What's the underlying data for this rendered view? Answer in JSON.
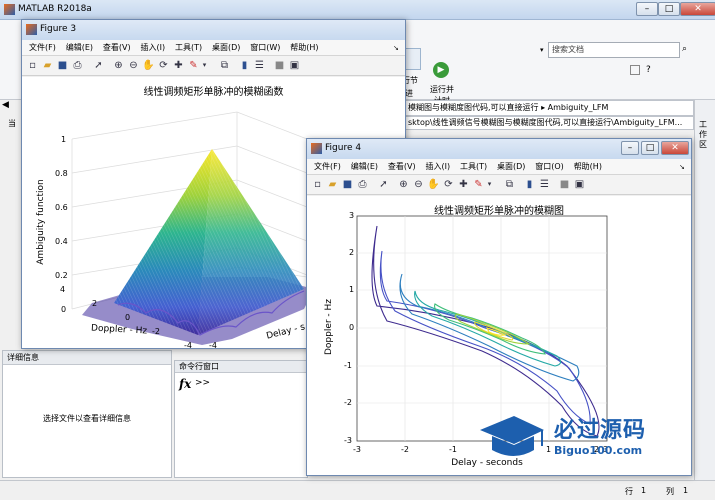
{
  "matlab": {
    "title": "MATLAB R2018a",
    "search_placeholder": "搜索文档",
    "ribbon": {
      "run_section_a": "行节",
      "run_section_b": "进",
      "run_and_time_a": "运行并",
      "run_and_time_b": "计时"
    },
    "address_bar": "模糊图与模糊度图代码,可以直接运行 ▸ Ambiguity_LFM",
    "path_bar": "sktop\\线性调频信号模糊图与模糊度图代码,可以直接运行\\Ambiguity_LFM...",
    "left_tab": "当",
    "details_panel": {
      "header": "详细信息",
      "message": "选择文件以查看详细信息"
    },
    "command_window": {
      "header": "命令行窗口",
      "fx": "fx",
      "prompt": ">>"
    },
    "workspace_tab": "工作区",
    "status": {
      "row_label": "行",
      "row_value": "1",
      "col_label": "列",
      "col_value": "1"
    },
    "colors": {
      "accent": "#3c7fb1",
      "title_bar": "#c7d9ef",
      "close_red": "#c9473a"
    }
  },
  "figure3": {
    "title": "Figure 3",
    "menu": [
      "文件(F)",
      "编辑(E)",
      "查看(V)",
      "插入(I)",
      "工具(T)",
      "桌面(D)",
      "窗口(W)",
      "帮助(H)"
    ],
    "plot_title": "线性调频矩形单脉冲的模糊函数",
    "zlabel": "Ambiguity function",
    "ylabel": "Doppler - Hz",
    "xlabel": "Delay - s",
    "z_ticks": [
      "1",
      "0.8",
      "0.6",
      "0.4",
      "0.2",
      "0"
    ],
    "doppler_ticks": [
      "4",
      "2",
      "0",
      "-2",
      "-4"
    ],
    "delay_ticks": [
      "-4"
    ]
  },
  "figure4": {
    "title": "Figure 4",
    "menu": [
      "文件(F)",
      "编辑(E)",
      "查看(V)",
      "插入(I)",
      "工具(T)",
      "桌面(D)",
      "窗口(O)",
      "帮助(H)"
    ],
    "plot_title": "线性调频矩形单脉冲的模糊图",
    "xlabel": "Delay - seconds",
    "ylabel": "Doppler - Hz",
    "x_ticks": [
      "-3",
      "-2",
      "-1",
      "0",
      "1",
      "2",
      "3"
    ],
    "y_ticks": [
      "3",
      "2",
      "1",
      "0",
      "-1",
      "-2",
      "-3"
    ]
  },
  "watermark": {
    "text": "必过源码",
    "url": "Biguo100.com"
  }
}
